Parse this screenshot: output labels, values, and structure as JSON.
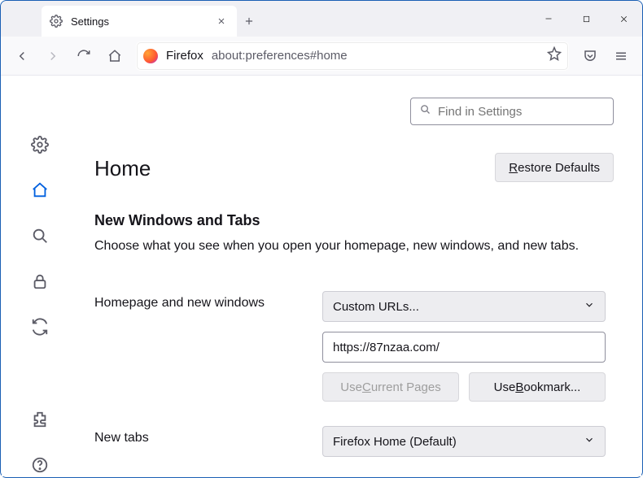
{
  "window": {
    "tab_label": "Settings",
    "min": "—",
    "max": "▢",
    "close": "✕"
  },
  "toolbar": {
    "identity": "Firefox",
    "url": "about:preferences#home"
  },
  "search": {
    "placeholder": "Find in Settings"
  },
  "page": {
    "title": "Home",
    "restore_pre": "R",
    "restore_post": "estore Defaults",
    "section_title": "New Windows and Tabs",
    "section_desc": "Choose what you see when you open your homepage, new windows, and new tabs.",
    "homepage_label": "Homepage and new windows",
    "homepage_select": "Custom URLs...",
    "homepage_url": "https://87nzaa.com/",
    "use_current_pre": "Use ",
    "use_current_u": "C",
    "use_current_post": "urrent Pages",
    "use_bookmark_pre": "Use ",
    "use_bookmark_u": "B",
    "use_bookmark_post": "ookmark...",
    "newtabs_label": "New tabs",
    "newtabs_select": "Firefox Home (Default)"
  },
  "sidebar": {
    "items": [
      "general",
      "home",
      "search",
      "privacy",
      "sync",
      "extensions",
      "support"
    ]
  }
}
